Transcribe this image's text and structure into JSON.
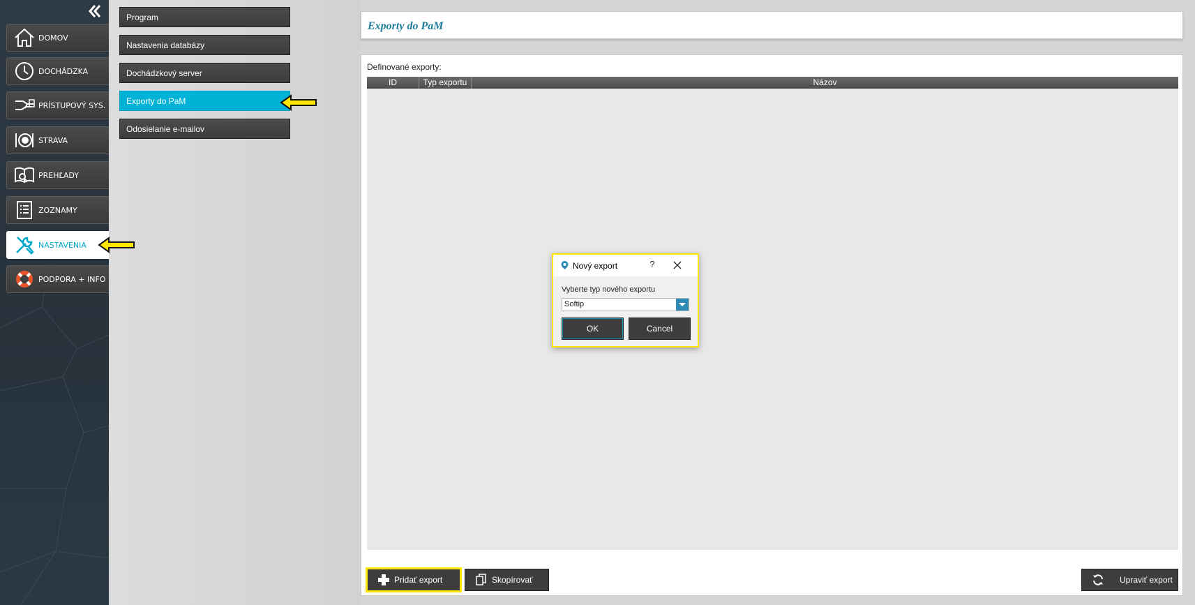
{
  "nav": {
    "items": [
      {
        "label": "DOMOV",
        "icon": "home-icon"
      },
      {
        "label": "DOCHÁDZKA",
        "icon": "clock-icon"
      },
      {
        "label": "PRÍSTUPOVÝ SYS.",
        "icon": "access-card-icon"
      },
      {
        "label": "STRAVA",
        "icon": "plate-icon"
      },
      {
        "label": "PREHĽADY",
        "icon": "book-search-icon"
      },
      {
        "label": "ZOZNAMY",
        "icon": "list-icon"
      },
      {
        "label": "NASTAVENIA",
        "icon": "tools-icon"
      },
      {
        "label": "PODPORA + INFO",
        "icon": "lifebuoy-icon"
      }
    ],
    "active": "NASTAVENIA"
  },
  "settings_menu": {
    "items": [
      "Program",
      "Nastavenia databázy",
      "Dochádzkový server",
      "Exporty do PaM",
      "Odosielanie e-mailov"
    ],
    "active": "Exporty do PaM"
  },
  "main": {
    "title": "Exporty do PaM",
    "section_label": "Definované exporty:",
    "columns": [
      "ID",
      "Typ exportu",
      "Názov"
    ],
    "rows": [],
    "buttons": {
      "add": "Pridať export",
      "copy": "Skopírovať",
      "edit": "Upraviť export"
    }
  },
  "dialog": {
    "title": "Nový export",
    "help": "?",
    "prompt": "Vyberte typ nového exportu",
    "selected_type": "Softip",
    "ok": "OK",
    "cancel": "Cancel"
  },
  "colors": {
    "accent": "#00b2d6",
    "title": "#1e7d9b",
    "highlight": "#ffe600"
  }
}
